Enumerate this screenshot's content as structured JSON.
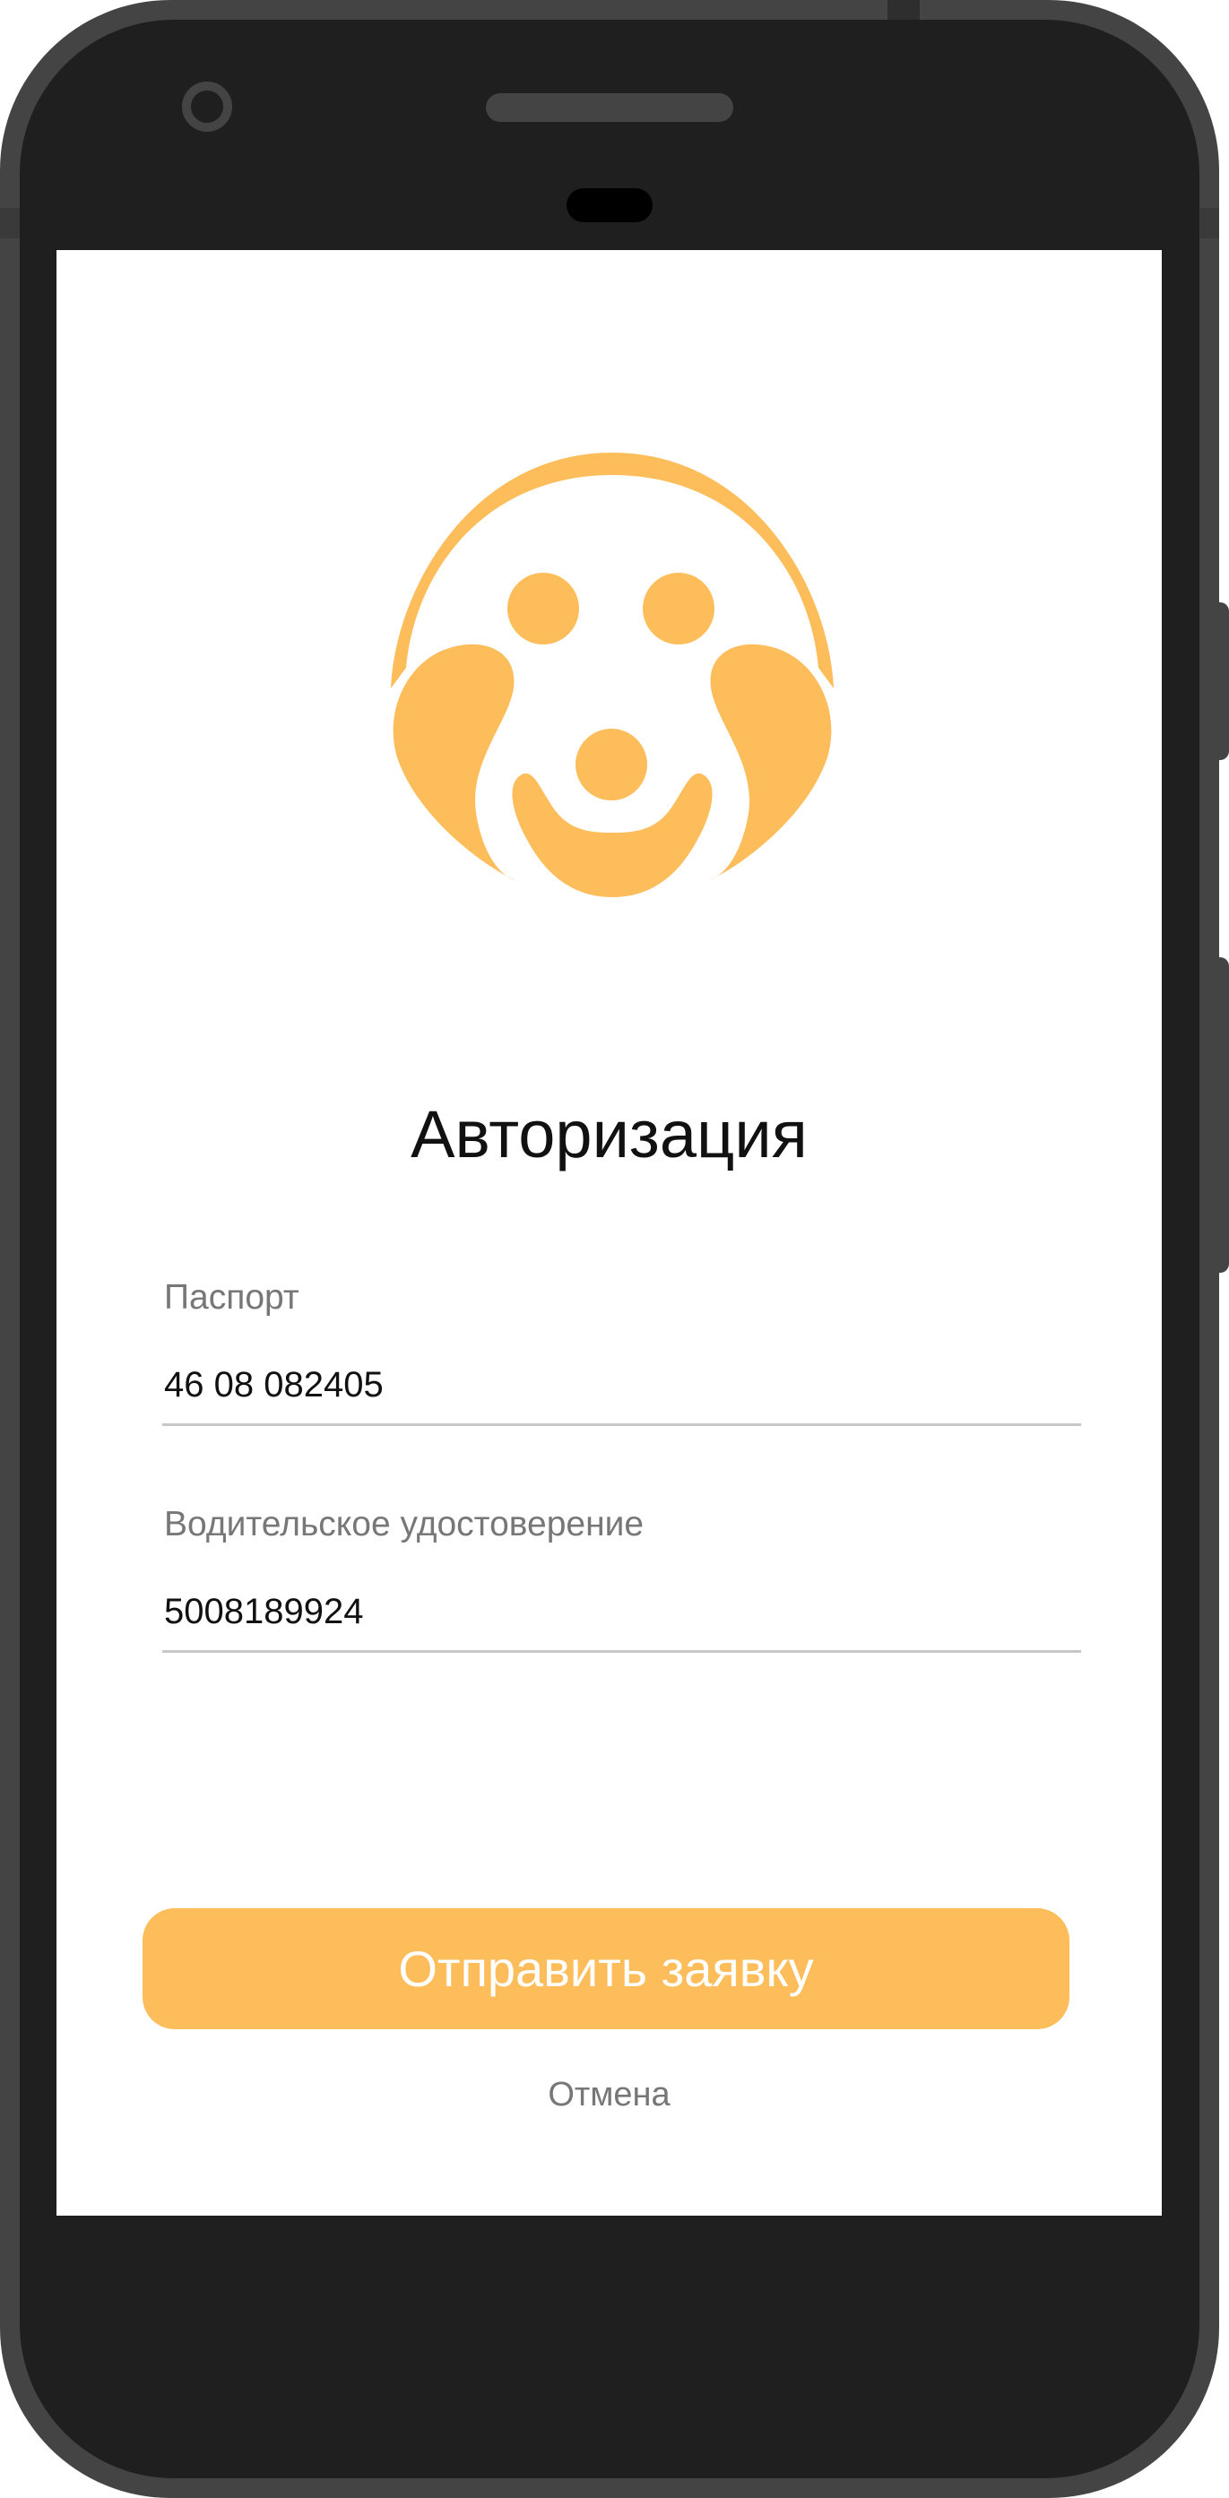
{
  "auth": {
    "title": "Авторизация",
    "passport": {
      "label": "Паспорт",
      "value": "46 08 082405"
    },
    "license": {
      "label": "Водительское удостоверение",
      "value": "5008189924"
    },
    "submit_label": "Отправить заявку",
    "cancel_label": "Отмена"
  },
  "colors": {
    "accent": "#fcbd5a",
    "device": "#1f1f1f",
    "label": "#777777"
  },
  "icons": {
    "logo": "dog-face-logo-icon",
    "camera": "front-camera-icon"
  }
}
